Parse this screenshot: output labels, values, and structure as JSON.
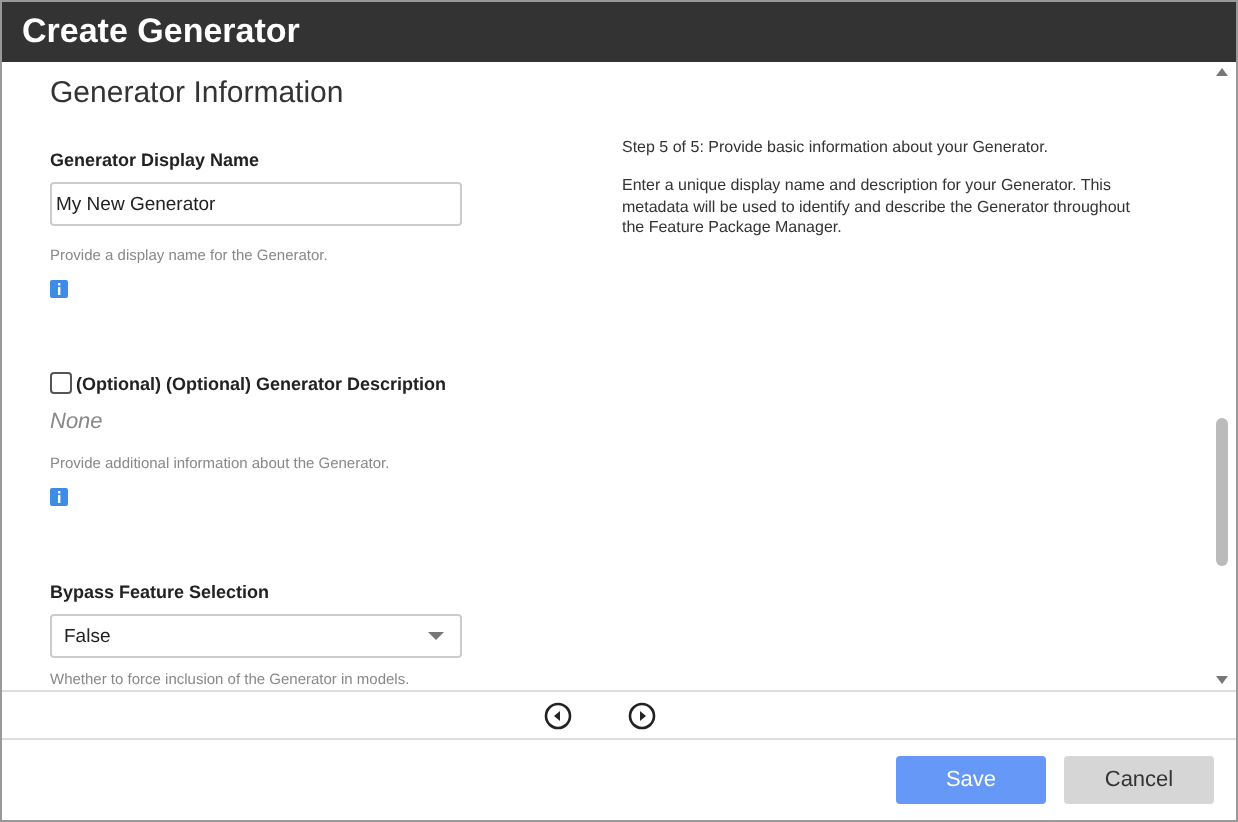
{
  "window": {
    "title": "Create Generator"
  },
  "section_title": "Generator Information",
  "fields": [
    {
      "kind": "text",
      "label": "Generator Display Name",
      "value": "My New Generator",
      "help": "Provide a display name for the Generator.",
      "info": true
    },
    {
      "kind": "optional",
      "label": "(Optional) (Optional) Generator Description",
      "checked": false,
      "value": "None",
      "help": "Provide additional information about the Generator.",
      "info": true
    },
    {
      "kind": "select",
      "label": "Bypass Feature Selection",
      "value": "False",
      "help": "Whether to force inclusion of the Generator in models."
    }
  ],
  "instructions": [
    "Step 5 of 5: Provide basic information about your Generator.",
    "Enter a unique display name and description for your Generator. This metadata will be used to identify and describe the Generator throughout the Feature Package Manager."
  ],
  "buttons": [
    {
      "label": "Save",
      "kind": "primary"
    },
    {
      "label": "Cancel",
      "kind": "secondary"
    }
  ]
}
